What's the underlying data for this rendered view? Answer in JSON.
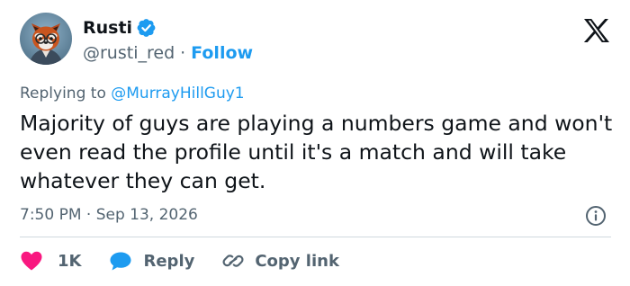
{
  "author": {
    "display_name": "Rusti",
    "handle": "@rusti_red",
    "separator": "·",
    "follow_label": "Follow"
  },
  "reply_context": {
    "prefix": "Replying to",
    "target": "@MurrayHillGuy1"
  },
  "tweet": {
    "text": "Majority of guys are playing a numbers game and won't even read the profile until it's a match and will take whatever they can get.",
    "time": "7:50 PM",
    "separator": "·",
    "date": "Sep 13, 2026"
  },
  "actions": {
    "like_count": "1K",
    "reply_label": "Reply",
    "copy_link_label": "Copy link"
  },
  "icons": {
    "verified": "verified-badge-icon",
    "brand": "x-logo-icon",
    "info": "info-icon",
    "like": "heart-icon",
    "reply": "speech-bubble-icon",
    "copy": "link-icon"
  },
  "colors": {
    "accent": "#1d9bf0",
    "text_primary": "#0f1419",
    "text_secondary": "#536471",
    "like": "#f91880",
    "divider": "#cfd9de"
  }
}
